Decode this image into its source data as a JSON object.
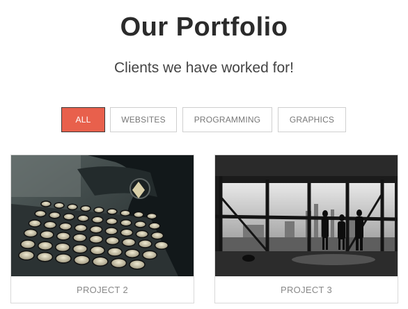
{
  "header": {
    "title": "Our Portfolio",
    "subtitle": "Clients we have worked for!"
  },
  "filters": {
    "items": [
      {
        "label": "ALL",
        "active": true
      },
      {
        "label": "WEBSITES",
        "active": false
      },
      {
        "label": "PROGRAMMING",
        "active": false
      },
      {
        "label": "GRAPHICS",
        "active": false
      }
    ],
    "accent": "#e8604c"
  },
  "projects": [
    {
      "label": "PROJECT 2",
      "image": "typewriter"
    },
    {
      "label": "PROJECT 3",
      "image": "city-window-silhouettes"
    }
  ]
}
